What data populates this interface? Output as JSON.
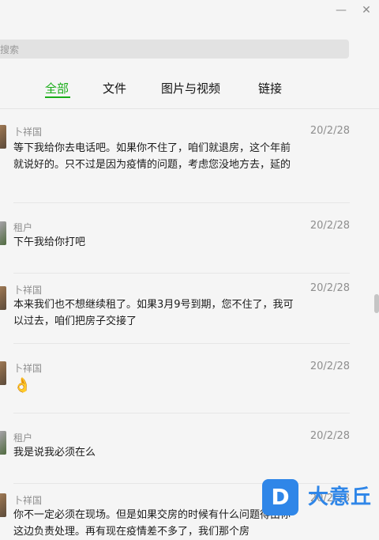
{
  "window": {
    "minimize_glyph": "—",
    "close_glyph": "✕"
  },
  "search": {
    "placeholder": "搜索"
  },
  "tabs": [
    {
      "label": "全部",
      "active": true
    },
    {
      "label": "文件",
      "active": false
    },
    {
      "label": "图片与视频",
      "active": false
    },
    {
      "label": "链接",
      "active": false
    }
  ],
  "messages": [
    {
      "sender": "卜祥国",
      "date": "20/2/28",
      "text": "等下我给你去电话吧。如果你不住了，咱们就退房，这个年前就说好的。只不过是因为疫情的问题，考虑您没地方去，延的"
    },
    {
      "sender": "租户",
      "date": "20/2/28",
      "text": "下午我给你打吧"
    },
    {
      "sender": "卜祥国",
      "date": "20/2/28",
      "text": "本来我们也不想继续租了。如果3月9号到期，您不住了，我可以过去，咱们把房子交接了"
    },
    {
      "sender": "卜祥国",
      "date": "20/2/28",
      "text": "👌"
    },
    {
      "sender": "租户",
      "date": "20/2/28",
      "text": "我是说我必须在么"
    },
    {
      "sender": "卜祥国",
      "date": "20/2/28",
      "text": "你不一定必须在现场。但是如果交房的时候有什么问题得由你这边负责处理。再有现在疫情差不多了，我们那个房"
    }
  ],
  "watermark": {
    "logo": "D",
    "text": "大意丘"
  },
  "colors": {
    "accent": "#1aad19",
    "watermark": "#2f86e8"
  }
}
